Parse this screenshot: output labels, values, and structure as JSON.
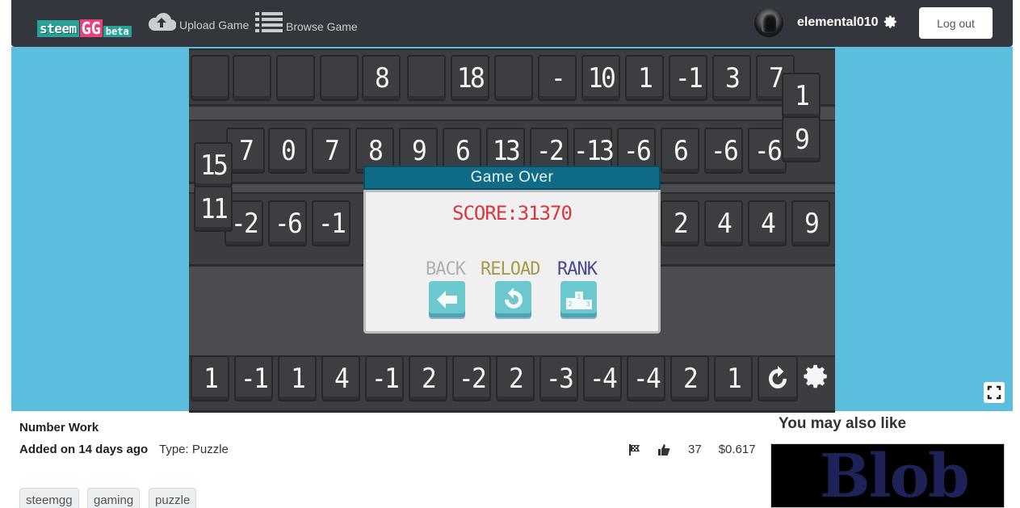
{
  "header": {
    "logo": {
      "part1": "steem",
      "part2": "GG",
      "part3": "beta"
    },
    "upload_label": "Upload Game",
    "browse_label": "Browse Game",
    "username": "elemental010",
    "logout_label": "Log out"
  },
  "game": {
    "row1": [
      "",
      "",
      "",
      "",
      "8",
      "",
      "18",
      "",
      "-",
      "10",
      "1",
      "-1",
      "3",
      "7"
    ],
    "row2": [
      "7",
      "0",
      "7",
      "8",
      "9",
      "6",
      "13",
      "-2",
      "-13",
      "-6",
      "6",
      "-6",
      "-6"
    ],
    "row3": [
      "-2",
      "-6",
      "-1",
      "2",
      "4",
      "4",
      "9"
    ],
    "left_stack": [
      "15",
      "11"
    ],
    "right_stack": [
      "1",
      "9"
    ],
    "bottom_row": [
      "1",
      "-1",
      "1",
      "4",
      "-1",
      "2",
      "-2",
      "2",
      "-3",
      "-4",
      "-4",
      "2",
      "1"
    ],
    "dialog": {
      "title": "Game Over",
      "score": "SCORE:31370",
      "back_label": "BACK",
      "reload_label": "RELOAD",
      "rank_label": "RANK",
      "rank_icon_digits": [
        "1",
        "2",
        "3"
      ]
    }
  },
  "info": {
    "title": "Number Work",
    "added": "Added on 14 days ago",
    "type": "Type: Puzzle",
    "likes": "37",
    "payout": "$0.617",
    "tags": [
      "steemgg",
      "gaming",
      "puzzle"
    ],
    "you_may_also_like": "You may also like",
    "suggestion_thumb_text": "Blob"
  }
}
